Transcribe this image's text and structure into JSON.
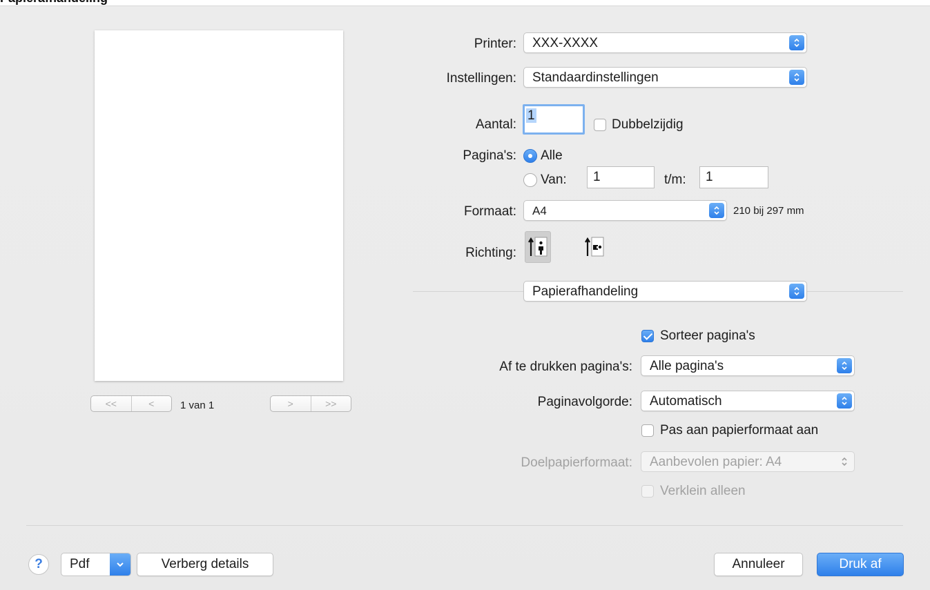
{
  "window_title": "Papierafhandeling",
  "preview": {
    "page_counter": "1 van 1",
    "nav_first": "<<",
    "nav_prev": "<",
    "nav_next": ">",
    "nav_last": ">>"
  },
  "printer": {
    "label": "Printer:",
    "value": "XXX-XXXX"
  },
  "settings": {
    "label": "Instellingen:",
    "value": "Standaardinstellingen"
  },
  "copies": {
    "label": "Aantal:",
    "value": "1",
    "duplex_label": "Dubbelzijdig",
    "duplex_checked": false
  },
  "pages": {
    "label": "Pagina's:",
    "all_label": "Alle",
    "all_selected": true,
    "from_label": "Van:",
    "from_value": "1",
    "to_label": "t/m:",
    "to_value": "1"
  },
  "format": {
    "label": "Formaat:",
    "value": "A4",
    "size_text": "210 bij 297 mm"
  },
  "orientation": {
    "label": "Richting:",
    "selected": "portrait"
  },
  "section": {
    "value": "Papierafhandeling"
  },
  "paper_handling": {
    "collate_label": "Sorteer pagina's",
    "collate_checked": true,
    "pages_to_print_label": "Af te drukken pagina's:",
    "pages_to_print_value": "Alle pagina's",
    "page_order_label": "Paginavolgorde:",
    "page_order_value": "Automatisch",
    "scale_label": "Pas aan papierformaat aan",
    "scale_checked": false,
    "dest_paper_label": "Doelpapierformaat:",
    "dest_paper_value": "Aanbevolen papier: A4",
    "scale_down_label": "Verklein alleen",
    "scale_down_checked": false
  },
  "footer": {
    "help_label": "?",
    "pdf_label": "Pdf",
    "hide_details_label": "Verberg details",
    "cancel_label": "Annuleer",
    "print_label": "Druk af"
  },
  "colors": {
    "accent": "#2f80ea",
    "background": "#ececec",
    "disabled_text": "#a2a2a2"
  },
  "icons": [
    "chevron-up-down-icon",
    "portrait-orientation-icon",
    "landscape-orientation-icon",
    "help-icon",
    "chevron-down-icon"
  ]
}
